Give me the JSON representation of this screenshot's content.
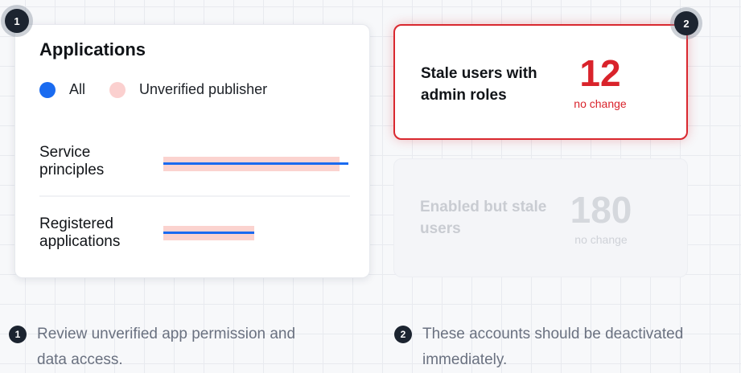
{
  "applications_card": {
    "title": "Applications",
    "legend": {
      "all_label": "All",
      "unverified_label": "Unverified publisher",
      "all_color": "#1a6bf0",
      "unverified_color": "#fbd3cf"
    },
    "rows": [
      {
        "label": "Service principles",
        "all_fraction": 1.0,
        "unverified_fraction": 0.95
      },
      {
        "label": "Registered applications",
        "all_fraction": 0.49,
        "unverified_fraction": 0.49
      }
    ]
  },
  "metrics": [
    {
      "label": "Stale users with admin roles",
      "value": "12",
      "change": "no change",
      "highlighted": true,
      "accent_color": "#d9232b"
    },
    {
      "label": "Enabled but stale users",
      "value": "180",
      "change": "no change",
      "highlighted": false
    }
  ],
  "markers": [
    "1",
    "2"
  ],
  "footnotes": [
    {
      "number": "1",
      "text": "Review unverified app permission and data access."
    },
    {
      "number": "2",
      "text": "These accounts should be deactivated immediately."
    }
  ]
}
